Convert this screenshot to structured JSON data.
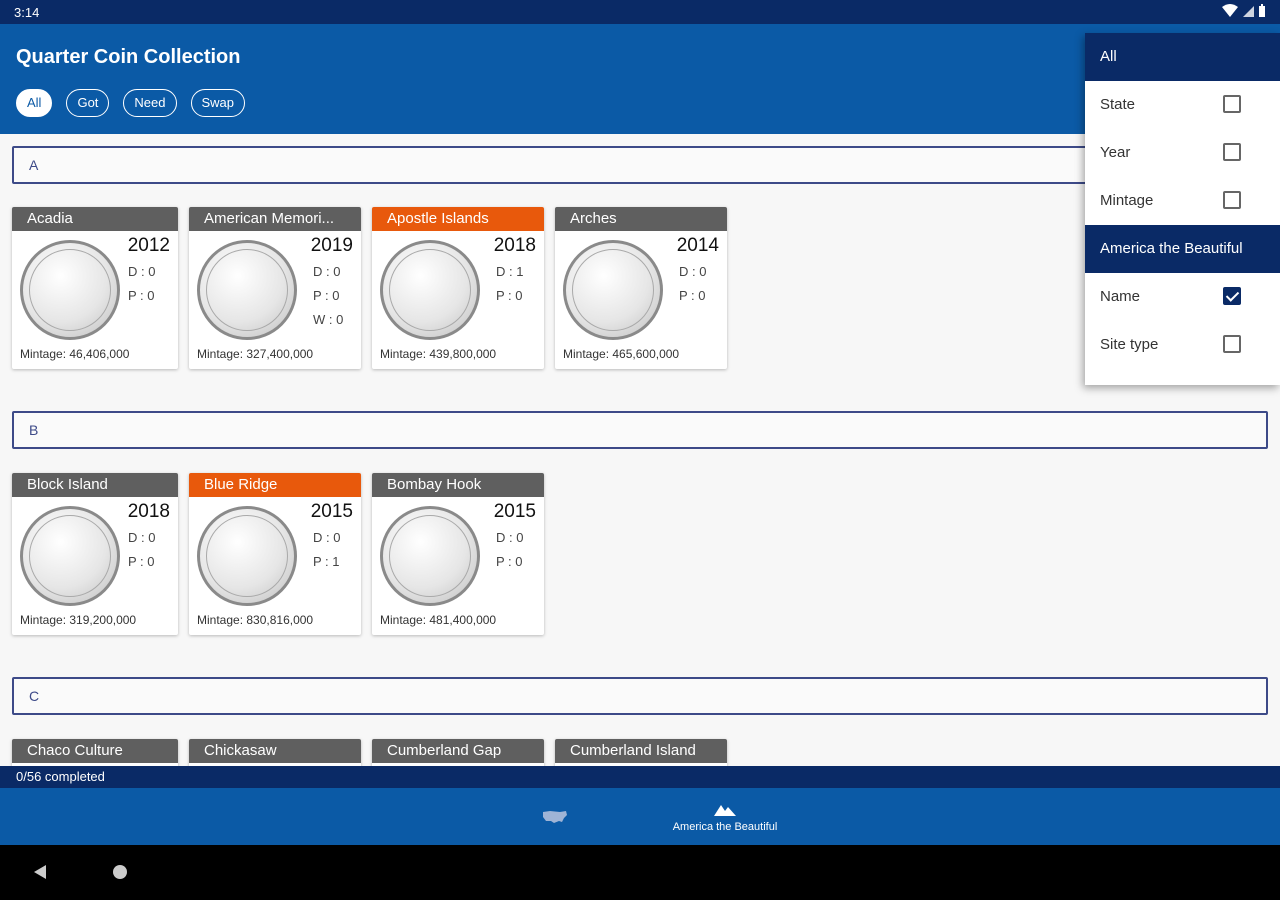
{
  "status": {
    "time": "3:14"
  },
  "app": {
    "title": "Quarter Coin Collection"
  },
  "filters": [
    "All",
    "Got",
    "Need",
    "Swap"
  ],
  "sections": [
    {
      "letter": "A",
      "coins": [
        {
          "name": "Acadia",
          "year": "2012",
          "d": "D : 0",
          "p": "P : 0",
          "w": "",
          "mintage": "Mintage: 46,406,000",
          "status": "normal"
        },
        {
          "name": "American Memori...",
          "year": "2019",
          "d": "D : 0",
          "p": "P : 0",
          "w": "W : 0",
          "mintage": "Mintage: 327,400,000",
          "status": "normal"
        },
        {
          "name": "Apostle Islands",
          "year": "2018",
          "d": "D : 1",
          "p": "P : 0",
          "w": "",
          "mintage": "Mintage: 439,800,000",
          "status": "need"
        },
        {
          "name": "Arches",
          "year": "2014",
          "d": "D : 0",
          "p": "P : 0",
          "w": "",
          "mintage": "Mintage: 465,600,000",
          "status": "normal"
        }
      ]
    },
    {
      "letter": "B",
      "coins": [
        {
          "name": "Block Island",
          "year": "2018",
          "d": "D : 0",
          "p": "P : 0",
          "w": "",
          "mintage": "Mintage: 319,200,000",
          "status": "normal"
        },
        {
          "name": "Blue Ridge",
          "year": "2015",
          "d": "D : 0",
          "p": "P : 1",
          "w": "",
          "mintage": "Mintage: 830,816,000",
          "status": "need"
        },
        {
          "name": "Bombay Hook",
          "year": "2015",
          "d": "D : 0",
          "p": "P : 0",
          "w": "",
          "mintage": "Mintage: 481,400,000",
          "status": "normal"
        }
      ]
    },
    {
      "letter": "C",
      "coins": [
        {
          "name": "Chaco Culture"
        },
        {
          "name": "Chickasaw"
        },
        {
          "name": "Cumberland Gap"
        },
        {
          "name": "Cumberland Island"
        }
      ]
    }
  ],
  "progress": "0/56 completed",
  "bottom_nav": {
    "active_label": "America the Beautiful"
  },
  "dropdown": {
    "group1_header": "All",
    "group1_items": [
      {
        "label": "State",
        "checked": false
      },
      {
        "label": "Year",
        "checked": false
      },
      {
        "label": "Mintage",
        "checked": false
      }
    ],
    "group2_header": "America the Beautiful",
    "group2_items": [
      {
        "label": "Name",
        "checked": true
      },
      {
        "label": "Site type",
        "checked": false
      }
    ]
  },
  "colors": {
    "appbar": "#0b5aa6",
    "dark_blue": "#0a2a66",
    "need_orange": "#e8590c",
    "card_header": "#5f5f5f"
  }
}
